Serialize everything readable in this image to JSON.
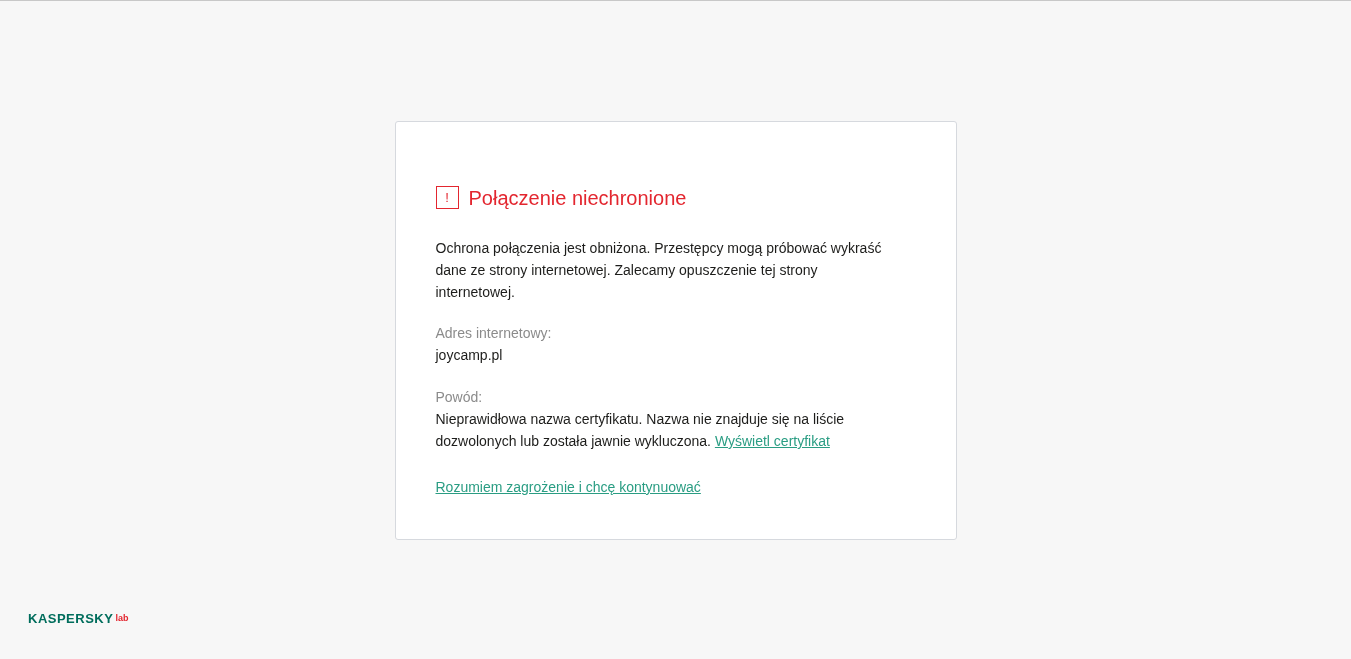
{
  "warning": {
    "title": "Połączenie niechronione",
    "icon": "!",
    "description": "Ochrona połączenia jest obniżona. Przestępcy mogą próbować wykraść dane ze strony internetowej. Zalecamy opuszczenie tej strony internetowej.",
    "address_label": "Adres internetowy:",
    "address": "joycamp.pl",
    "reason_label": "Powód:",
    "reason": "Nieprawidłowa nazwa certyfikatu. Nazwa nie znajduje się na liście dozwolonych lub została jawnie wykluczona.",
    "certificate_link": "Wyświetl certyfikat",
    "continue_link": "Rozumiem zagrożenie i chcę kontynuować"
  },
  "logo": {
    "text": "KASPERSKY",
    "suffix": "lab"
  }
}
